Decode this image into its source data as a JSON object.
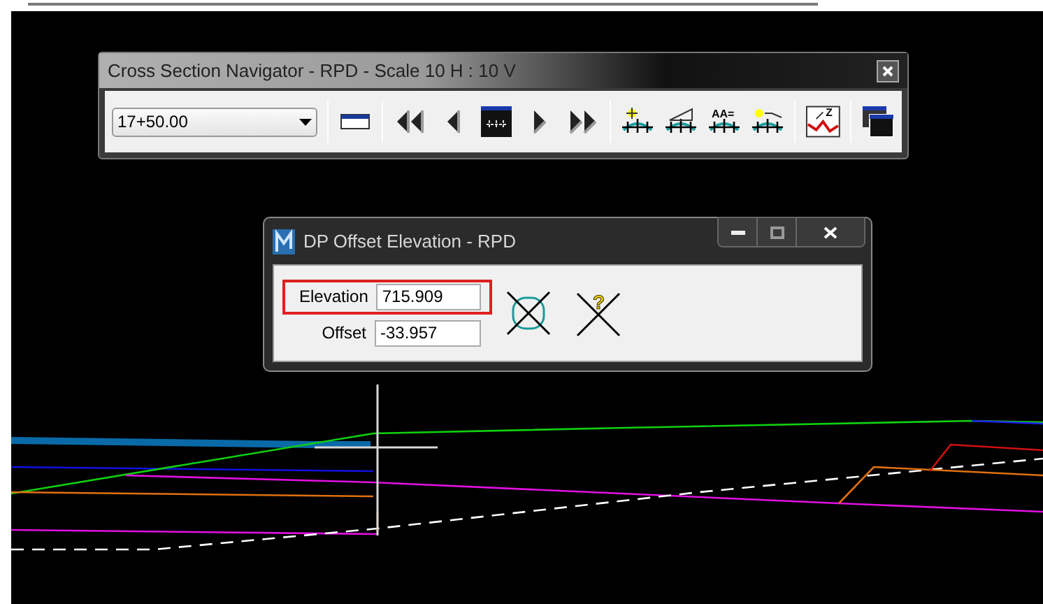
{
  "navigator": {
    "title": "Cross Section Navigator - RPD - Scale 10 H : 10 V",
    "station": "17+50.00",
    "toolbar": [
      {
        "kind": "separator"
      },
      {
        "kind": "bar"
      },
      {
        "kind": "separator"
      },
      {
        "kind": "first"
      },
      {
        "kind": "previous"
      },
      {
        "kind": "screen"
      },
      {
        "kind": "next"
      },
      {
        "kind": "last"
      },
      {
        "kind": "separator"
      },
      {
        "kind": "point-dot"
      },
      {
        "kind": "slope"
      },
      {
        "kind": "annotate",
        "glyph": "AA="
      },
      {
        "kind": "point-line"
      },
      {
        "kind": "separator"
      },
      {
        "kind": "profile",
        "glyph": "Z"
      },
      {
        "kind": "separator"
      },
      {
        "kind": "windows"
      }
    ]
  },
  "dp_window": {
    "title": "DP Offset Elevation - RPD",
    "fields": [
      {
        "label": "Elevation",
        "value": "715.909",
        "highlighted": true
      },
      {
        "label": "Offset",
        "value": "-33.957",
        "highlighted": false
      }
    ],
    "tools": [
      {
        "kind": "circle-cross"
      },
      {
        "kind": "question-cross",
        "glyph": "?"
      }
    ]
  }
}
